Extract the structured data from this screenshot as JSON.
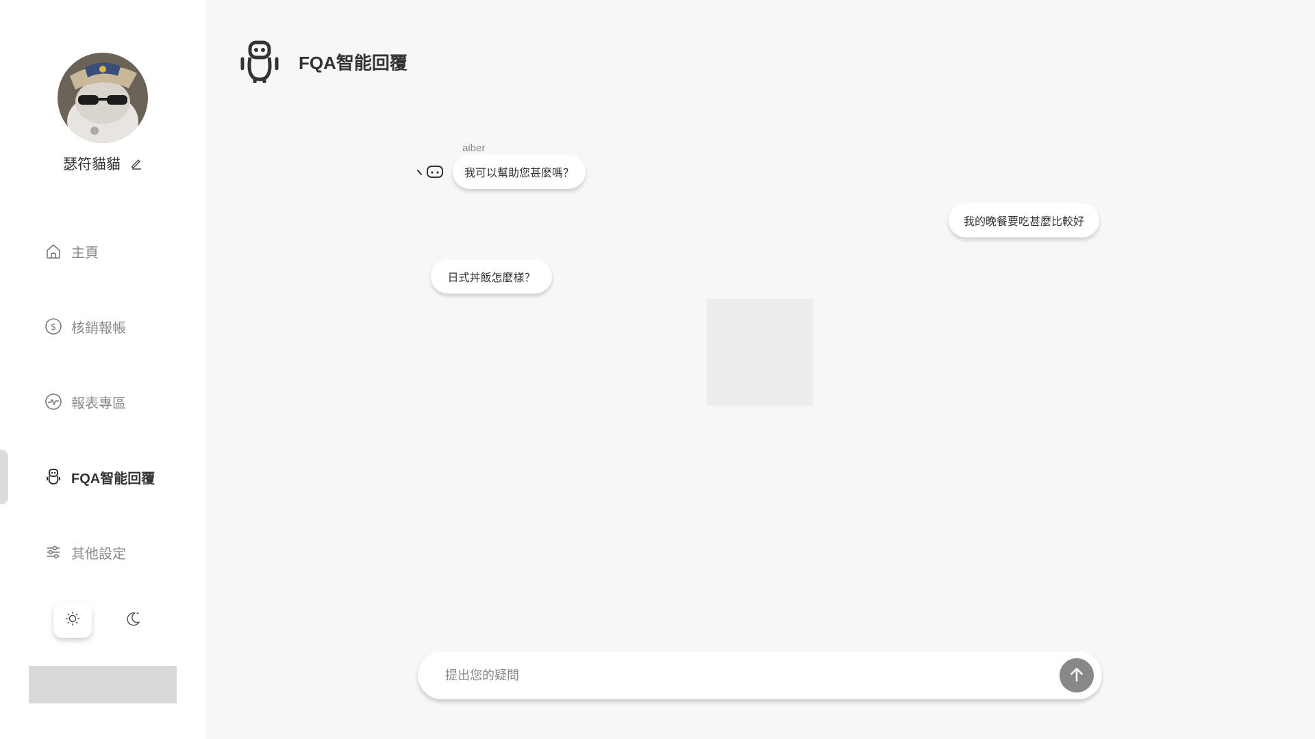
{
  "user": {
    "name": "瑟符貓貓"
  },
  "nav": {
    "items": [
      {
        "label": "主頁",
        "icon": "home-icon"
      },
      {
        "label": "核銷報帳",
        "icon": "dollar-icon"
      },
      {
        "label": "報表專區",
        "icon": "chart-icon"
      },
      {
        "label": "FQA智能回覆",
        "icon": "robot-icon",
        "active": true
      },
      {
        "label": "其他設定",
        "icon": "sliders-icon"
      }
    ]
  },
  "theme": {
    "options": [
      {
        "icon": "sun-icon",
        "selected": true
      },
      {
        "icon": "moon-icon",
        "selected": false
      }
    ]
  },
  "header": {
    "title": "FQA智能回覆",
    "icon": "robot-icon"
  },
  "chat": {
    "bot_name": "aiber",
    "messages": [
      {
        "from": "bot",
        "text": "我可以幫助您甚麼嗎？"
      },
      {
        "from": "user",
        "text": "我的晚餐要吃甚麼比較好"
      },
      {
        "from": "bot",
        "text": "日式丼飯怎麼樣？"
      }
    ]
  },
  "input": {
    "placeholder": "提出您的疑問",
    "value": ""
  },
  "colors": {
    "background": "#f7f7f7",
    "sidebar": "#ffffff",
    "send_button": "#888888",
    "text": "#333333"
  }
}
